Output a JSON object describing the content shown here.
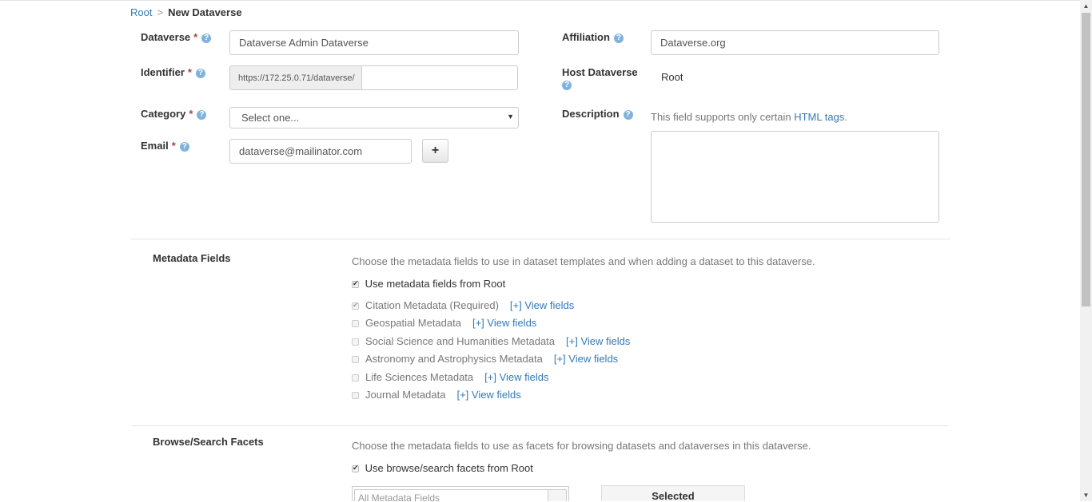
{
  "breadcrumb": {
    "root": "Root",
    "separator": ">",
    "current": "New Dataverse"
  },
  "form": {
    "dataverse": {
      "label": "Dataverse",
      "required_mark": "*",
      "help_icon": "?",
      "value": "Dataverse Admin Dataverse"
    },
    "identifier": {
      "label": "Identifier",
      "required_mark": "*",
      "help_icon": "?",
      "prefix": "https://172.25.0.71/dataverse/",
      "value": ""
    },
    "category": {
      "label": "Category",
      "required_mark": "*",
      "help_icon": "?",
      "selected": "Select one...",
      "arrow": "▼"
    },
    "email": {
      "label": "Email",
      "required_mark": "*",
      "help_icon": "?",
      "value": "dataverse@mailinator.com",
      "add_label": "+"
    },
    "affiliation": {
      "label": "Affiliation",
      "help_icon": "?",
      "value": "Dataverse.org"
    },
    "host_dataverse": {
      "label": "Host Dataverse",
      "help_icon": "?",
      "value": "Root"
    },
    "description": {
      "label": "Description",
      "help_icon": "?",
      "note": "This field supports only certain",
      "note_link": "HTML tags",
      "note_end": ".",
      "value": ""
    }
  },
  "metadata_fields": {
    "title": "Metadata Fields",
    "intro": "Choose the metadata fields to use in dataset templates and when adding a dataset to this dataverse.",
    "use_root_label": "Use metadata fields from Root",
    "use_root_checked": true,
    "blocks": [
      {
        "name": "Citation Metadata (Required)",
        "checked": true,
        "view": "[+] View fields"
      },
      {
        "name": "Geospatial Metadata",
        "checked": false,
        "view": "[+] View fields"
      },
      {
        "name": "Social Science and Humanities Metadata",
        "checked": false,
        "view": "[+] View fields"
      },
      {
        "name": "Astronomy and Astrophysics Metadata",
        "checked": false,
        "view": "[+] View fields"
      },
      {
        "name": "Life Sciences Metadata",
        "checked": false,
        "view": "[+] View fields"
      },
      {
        "name": "Journal Metadata",
        "checked": false,
        "view": "[+] View fields"
      }
    ]
  },
  "facets": {
    "title": "Browse/Search Facets",
    "intro": "Choose the metadata fields to use as facets for browsing datasets and dataverses in this dataverse.",
    "use_root_label": "Use browse/search facets from Root",
    "use_root_checked": true,
    "available_header": "All Metadata Fields",
    "selected_header": "Selected"
  },
  "scrollbar": {
    "up": "▲",
    "down": "▼"
  }
}
